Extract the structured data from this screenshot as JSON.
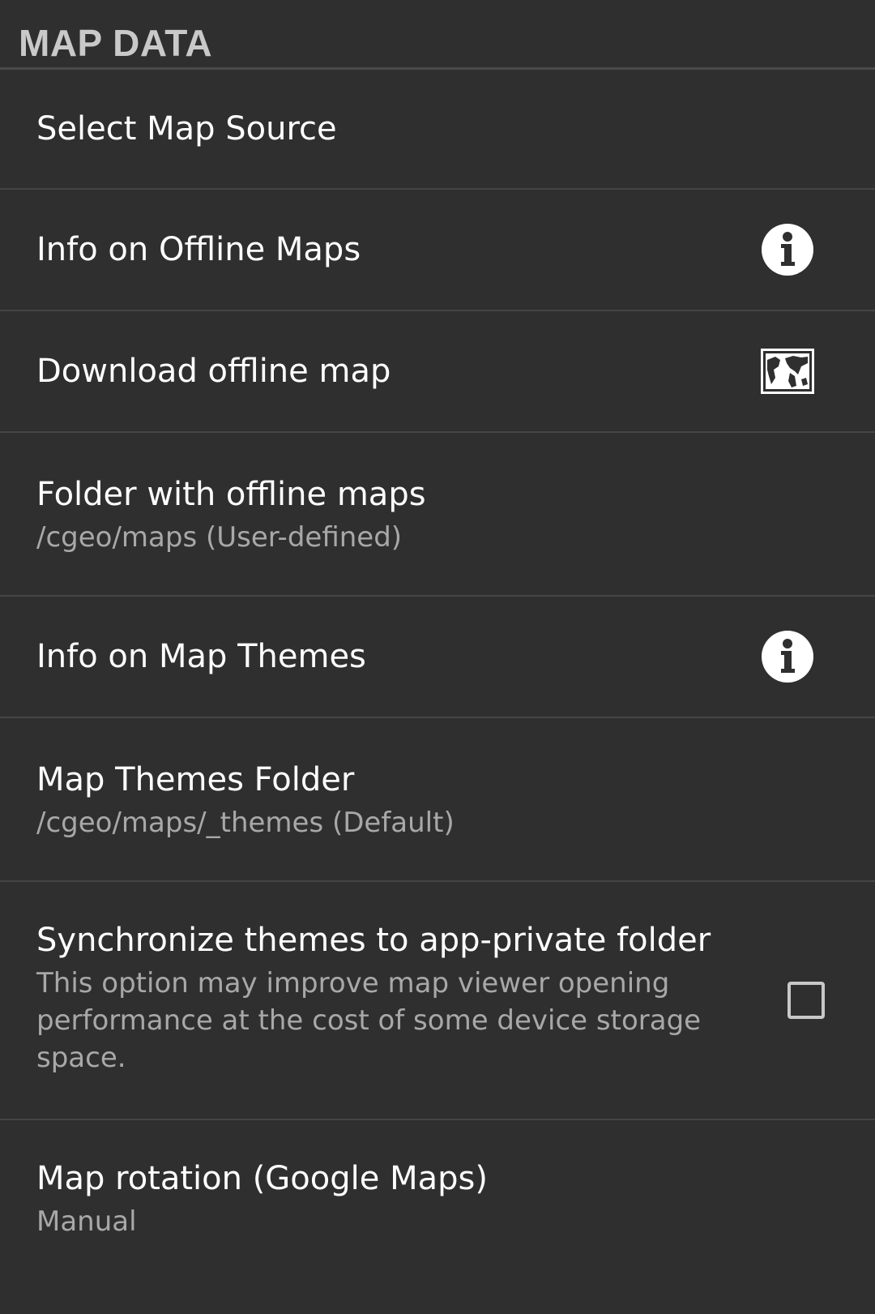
{
  "section": {
    "header": "MAP DATA"
  },
  "items": [
    {
      "title": "Select Map Source"
    },
    {
      "title": "Info on Offline Maps",
      "icon": "info-icon"
    },
    {
      "title": "Download offline map",
      "icon": "world-map-icon"
    },
    {
      "title": "Folder with offline maps",
      "summary": "/cgeo/maps (User-defined)"
    },
    {
      "title": "Info on Map Themes",
      "icon": "info-icon"
    },
    {
      "title": "Map Themes Folder",
      "summary": "/cgeo/maps/_themes (Default)"
    },
    {
      "title": "Synchronize themes to app-private folder",
      "summary": "This option may improve map viewer opening performance at the cost of some device storage space.",
      "checked": false
    },
    {
      "title": "Map rotation (Google Maps)",
      "summary": "Manual"
    }
  ],
  "colors": {
    "background": "#2f2f2f",
    "header_text": "#c9c9c9",
    "title_text": "#ffffff",
    "summary_text": "#a8a8a8",
    "divider": "#454545"
  }
}
